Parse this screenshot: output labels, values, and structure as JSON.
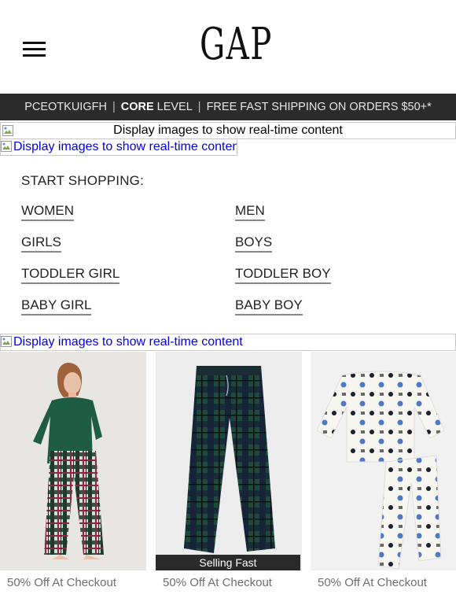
{
  "header": {
    "logo_text": "GAP",
    "menu_icon": "hamburger-menu-icon"
  },
  "promo_bar": {
    "member_id": "PCEOTKUIGFH",
    "separator": "|",
    "level_bold": "CORE",
    "level_suffix": " LEVEL",
    "shipping": "FREE FAST SHIPPING ON ORDERS $50+*"
  },
  "image_placeholders": {
    "banner_text": "Display images to show real-time content",
    "link_text_1": "Display images to show real-time content",
    "link_text_2": "Display images to show real-time content",
    "icon": "broken-image-icon"
  },
  "start_shopping": {
    "title": "START SHOPPING:",
    "categories": [
      "WOMEN",
      "MEN",
      "GIRLS",
      "BOYS",
      "TODDLER GIRL",
      "TODDLER BOY",
      "BABY GIRL",
      "BABY BOY"
    ]
  },
  "products": [
    {
      "image": "woman-in-green-top-and-plaid-pajama-pants",
      "badge": "",
      "offer": "50% Off At Checkout"
    },
    {
      "image": "green-navy-plaid-pajama-pants",
      "badge": "Selling Fast",
      "offer": "50% Off At Checkout"
    },
    {
      "image": "white-hanukkah-print-kids-pajama-set",
      "badge": "",
      "offer": "50% Off At Checkout"
    }
  ],
  "colors": {
    "promo_bg": "#2b2b2b",
    "link_blue": "#0000ee",
    "offer_gray": "#6f6f6f"
  }
}
